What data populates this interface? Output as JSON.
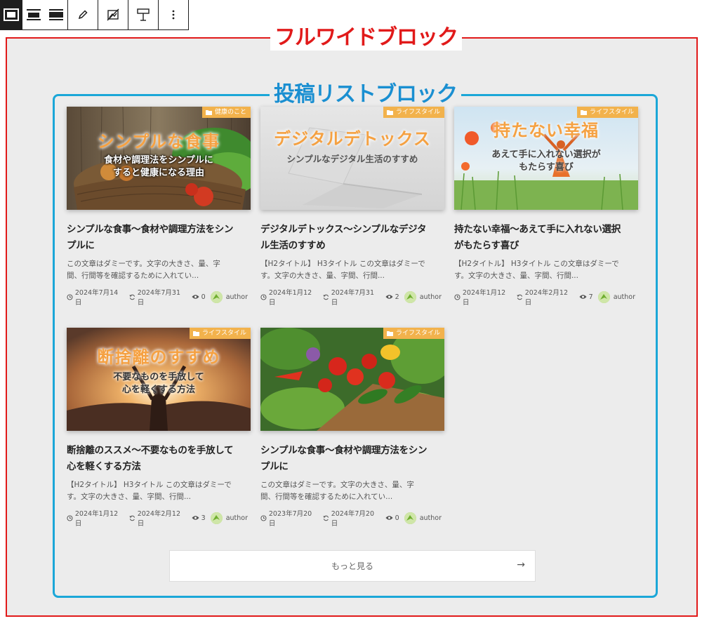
{
  "toolbar": {
    "buttons": [
      "align-none-icon",
      "align-wide-icon",
      "align-full-icon",
      "pencil-icon",
      "no-image-icon",
      "height-icon",
      "more-options-icon"
    ]
  },
  "annotations": {
    "full_width_label": "フルワイドブロック",
    "post_list_label": "投稿リストブロック",
    "full_width_color": "#e11a1a",
    "post_list_color": "#1ba7d8"
  },
  "posts": [
    {
      "category": "健康のこと",
      "thumb_title": "シンプルな食事",
      "thumb_sub_1": "食材や調理法をシンプルに",
      "thumb_sub_2": "すると健康になる理由",
      "title_1": "シンプルな食事～食材や調理方法をシン",
      "title_2": "プルに",
      "excerpt_1": "この文章はダミーです。文字の大きさ、量、字",
      "excerpt_2": "間、行間等を確認するために入れてい...",
      "published": "2024年7月14日",
      "updated": "2024年7月31日",
      "views": "0",
      "author": "author"
    },
    {
      "category": "ライフスタイル",
      "thumb_title": "デジタルデトックス",
      "thumb_sub_1": "シンプルなデジタル生活のすすめ",
      "thumb_sub_2": "",
      "title_1": "デジタルデトックス～シンプルなデジタ",
      "title_2": "ル生活のすすめ",
      "excerpt_1": "【H2タイトル】 H3タイトル この文章はダミーで",
      "excerpt_2": "す。文字の大きさ、量、字間、行間...",
      "published": "2024年1月12日",
      "updated": "2024年7月31日",
      "views": "2",
      "author": "author"
    },
    {
      "category": "ライフスタイル",
      "thumb_title": "持たない幸福",
      "thumb_sub_1": "あえて手に入れない選択が",
      "thumb_sub_2": "もたらす喜び",
      "title_1": "持たない幸福～あえて手に入れない選択",
      "title_2": "がもたらす喜び",
      "excerpt_1": "【H2タイトル】 H3タイトル この文章はダミーで",
      "excerpt_2": "す。文字の大きさ、量、字間、行間...",
      "published": "2024年1月12日",
      "updated": "2024年2月12日",
      "views": "7",
      "author": "author"
    },
    {
      "category": "ライフスタイル",
      "thumb_title": "断捨離のすすめ",
      "thumb_sub_1": "不要なものを手放して",
      "thumb_sub_2": "心を軽くする方法",
      "title_1": "断捨離のススメ～不要なものを手放して",
      "title_2": "心を軽くする方法",
      "excerpt_1": "【H2タイトル】 H3タイトル この文章はダミーで",
      "excerpt_2": "す。文字の大きさ、量、字間、行間...",
      "published": "2024年1月12日",
      "updated": "2024年2月12日",
      "views": "3",
      "author": "author"
    },
    {
      "category": "ライフスタイル",
      "thumb_title": "",
      "thumb_sub_1": "",
      "thumb_sub_2": "",
      "title_1": "シンプルな食事～食材や調理方法をシン",
      "title_2": "プルに",
      "excerpt_1": "この文章はダミーです。文字の大きさ、量、字",
      "excerpt_2": "間、行間等を確認するために入れてい...",
      "published": "2023年7月20日",
      "updated": "2024年7月20日",
      "views": "0",
      "author": "author"
    }
  ],
  "more_button": {
    "label": "もっと見る",
    "arrow": "→"
  }
}
